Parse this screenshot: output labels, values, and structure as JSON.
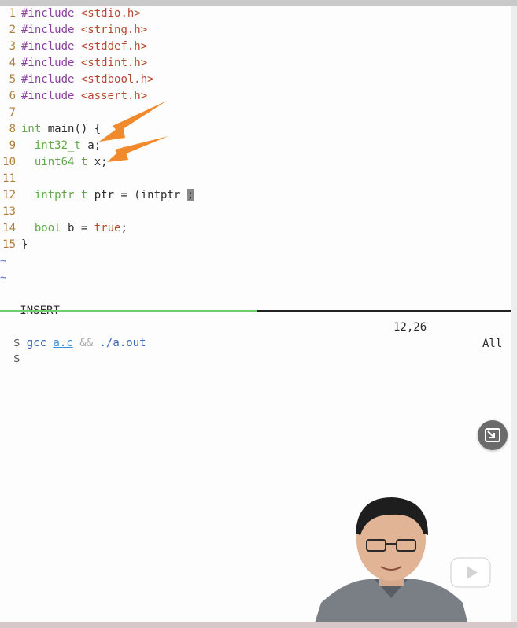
{
  "editor": {
    "lines": [
      {
        "n": "1",
        "pre": "#include",
        "arg": "<stdio.h>"
      },
      {
        "n": "2",
        "pre": "#include",
        "arg": "<string.h>"
      },
      {
        "n": "3",
        "pre": "#include",
        "arg": "<stddef.h>"
      },
      {
        "n": "4",
        "pre": "#include",
        "arg": "<stdint.h>"
      },
      {
        "n": "5",
        "pre": "#include",
        "arg": "<stdbool.h>"
      },
      {
        "n": "6",
        "pre": "#include",
        "arg": "<assert.h>"
      },
      {
        "n": "7"
      },
      {
        "n": "8",
        "type": "int",
        "rest": " main() {"
      },
      {
        "n": "9",
        "indent": "  ",
        "type": "int32_t",
        "rest": " a;"
      },
      {
        "n": "10",
        "indent": "  ",
        "type": "uint64_t",
        "rest": " x;"
      },
      {
        "n": "11"
      },
      {
        "n": "12",
        "indent": "  ",
        "type": "intptr_t",
        "rest": " ptr = (intptr_",
        "cursor": ";"
      },
      {
        "n": "13"
      },
      {
        "n": "14",
        "indent": "  ",
        "type": "bool",
        "rest": " b = ",
        "lit": "true",
        "tail": ";"
      },
      {
        "n": "15",
        "rest": "}"
      }
    ],
    "empty_markers": [
      "~",
      "~"
    ]
  },
  "status": {
    "mode": "-- INSERT --",
    "position": "12,26",
    "scroll": "All"
  },
  "terminal": {
    "prompt": "$",
    "cmd": "gcc",
    "file": "a.c",
    "op": "&&",
    "run": "./a.out",
    "prompt2": "$"
  },
  "colors": {
    "preprocessor": "#8a3f9e",
    "string": "#b5482f",
    "type": "#5fa84a",
    "arrow": "#f08a2c",
    "divider_active": "#6fcf6f"
  },
  "icons": {
    "pip": "picture-in-picture-icon",
    "bili": "bilibili-tv-icon",
    "arrow": "annotation-arrow-icon"
  }
}
